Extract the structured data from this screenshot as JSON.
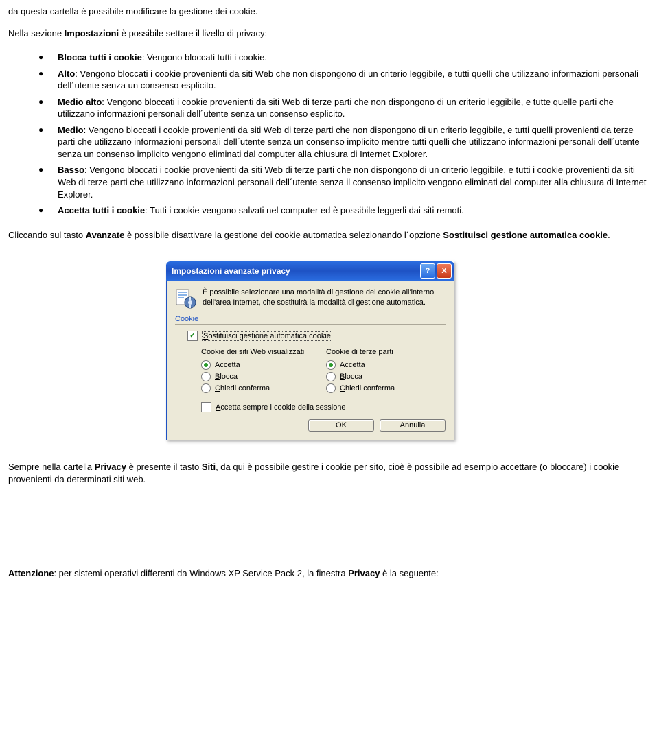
{
  "intro": {
    "line1": "da questa cartella è possibile modificare la gestione dei cookie.",
    "line2_a": "Nella sezione ",
    "line2_b": "Impostazioni",
    "line2_c": " è possibile settare il livello di privacy:"
  },
  "bullets": [
    {
      "head": "Blocca tutti i cookie",
      "text": ": Vengono bloccati tutti i cookie."
    },
    {
      "head": "Alto",
      "text": ": Vengono bloccati i cookie provenienti da siti Web che non dispongono di un criterio leggibile, e tutti quelli che utilizzano informazioni personali dell´utente senza un consenso esplicito."
    },
    {
      "head": "Medio alto",
      "text": ": Vengono bloccati i cookie provenienti da siti Web di terze parti che non dispongono di un criterio leggibile, e tutte quelle parti che utilizzano informazioni personali dell´utente senza un consenso esplicito."
    },
    {
      "head": "Medio",
      "text": ": Vengono bloccati i cookie provenienti da siti Web di terze parti che non dispongono di un criterio leggibile, e tutti quelli provenienti da terze parti che utilizzano informazioni personali dell´utente senza un consenso implicito mentre tutti quelli che utilizzano informazioni personali dell´utente senza un consenso implicito vengono eliminati dal computer alla chiusura di Internet Explorer."
    },
    {
      "head": "Basso",
      "text": ": Vengono bloccati i cookie provenienti da siti Web di terze parti che non dispongono di un criterio leggibile. e tutti i cookie provenienti da siti Web di terze parti che utilizzano informazioni personali dell´utente senza il consenso implicito vengono eliminati dal computer alla chiusura di Internet Explorer."
    },
    {
      "head": "Accetta tutti i cookie",
      "text": ": Tutti i cookie vengono salvati nel computer ed è possibile leggerli dai siti remoti."
    }
  ],
  "mid": {
    "a": "Cliccando sul tasto ",
    "b": "Avanzate",
    "c": " è possibile disattivare la gestione dei cookie automatica selezionando l´opzione ",
    "d": "Sostituisci gestione automatica cookie",
    "e": "."
  },
  "dialog": {
    "title": "Impostazioni avanzate privacy",
    "help": "?",
    "close": "X",
    "intro": "È possibile selezionare una modalità di gestione dei cookie all'interno dell'area Internet, che sostituirà la modalità di gestione automatica.",
    "section": "Cookie",
    "override_pre": "S",
    "override_rest": "ostituisci gestione automatica cookie",
    "col1": "Cookie dei siti Web visualizzati",
    "col2": "Cookie di terze parti",
    "opt_accept_pre": "A",
    "opt_accept_rest": "ccetta",
    "opt_block_pre": "B",
    "opt_block_rest": "locca",
    "opt_prompt_pre": "C",
    "opt_prompt_rest": "hiedi conferma",
    "session_pre": "A",
    "session_rest": "ccetta sempre i cookie della sessione",
    "ok": "OK",
    "cancel": "Annulla"
  },
  "after": {
    "a": "Sempre nella cartella ",
    "b": "Privacy",
    "c": " è presente il tasto ",
    "d": "Siti",
    "e": ", da qui è possibile gestire i cookie per sito, cioè è possibile ad esempio accettare (o bloccare) i cookie provenienti da determinati siti web."
  },
  "footer": {
    "a": "Attenzione",
    "b": ": per sistemi operativi differenti da Windows XP Service Pack 2, la finestra ",
    "c": "Privacy",
    "d": " è la seguente:"
  }
}
